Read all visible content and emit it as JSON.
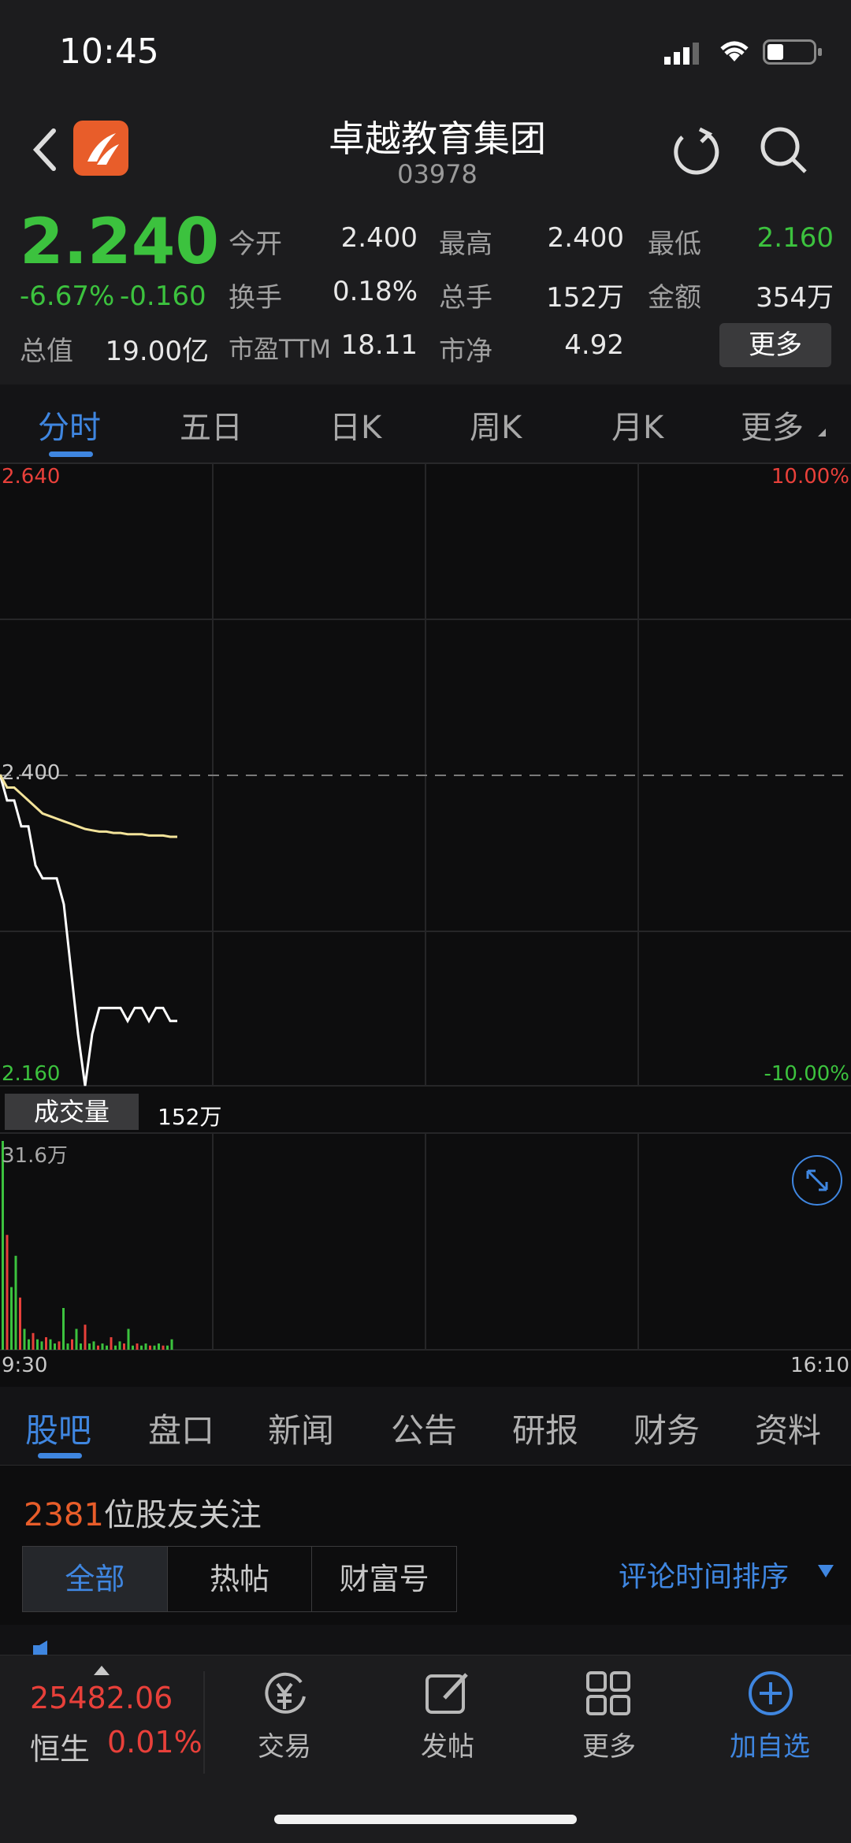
{
  "status_bar": {
    "time": "10:45"
  },
  "header": {
    "title": "卓越教育集团",
    "code": "03978"
  },
  "quote": {
    "price": "2.240",
    "change_pct": "-6.67%",
    "change_abs": "-0.160",
    "rows": [
      [
        {
          "label": "今开",
          "value": "2.400"
        },
        {
          "label": "最高",
          "value": "2.400"
        },
        {
          "label": "最低",
          "value": "2.160"
        }
      ],
      [
        {
          "label": "换手",
          "value": "0.18%"
        },
        {
          "label": "总手",
          "value": "152万"
        },
        {
          "label": "金额",
          "value": "354万"
        }
      ]
    ],
    "row3": {
      "total_label": "总值",
      "total_value": "19.00亿",
      "pe_label": "市盈TTM",
      "pe_value": "18.11",
      "pb_label": "市净",
      "pb_value": "4.92"
    },
    "more_button": "更多"
  },
  "chart_tabs": [
    "分时",
    "五日",
    "日K",
    "周K",
    "月K",
    "更多"
  ],
  "chart_data": {
    "type": "line",
    "y_left_ticks": [
      "2.640",
      "2.400",
      "2.160"
    ],
    "y_right_ticks": [
      "10.00%",
      "-10.00%"
    ],
    "ylim": [
      2.16,
      2.64
    ],
    "prev_close": 2.4,
    "series": [
      {
        "values": [
          2.4,
          2.38,
          2.38,
          2.36,
          2.36,
          2.33,
          2.32,
          2.32,
          2.32,
          2.3,
          2.25,
          2.2,
          2.16,
          2.2,
          2.22,
          2.22,
          2.22,
          2.22,
          2.21,
          2.22,
          2.22,
          2.21,
          2.22,
          2.22,
          2.21,
          2.21
        ]
      },
      {
        "values": [
          2.4,
          2.39,
          2.39,
          2.385,
          2.38,
          2.375,
          2.37,
          2.368,
          2.366,
          2.364,
          2.362,
          2.36,
          2.358,
          2.357,
          2.356,
          2.356,
          2.355,
          2.355,
          2.354,
          2.354,
          2.354,
          2.353,
          2.353,
          2.353,
          2.352,
          2.352
        ]
      }
    ],
    "volume": {
      "label": "成交量",
      "total": "152万",
      "max_label": "31.6万",
      "x_start": "9:30",
      "x_end": "16:10",
      "bars": [
        1.0,
        0.55,
        0.3,
        0.45,
        0.25,
        0.1,
        0.05,
        0.08,
        0.05,
        0.04,
        0.06,
        0.05,
        0.03,
        0.04,
        0.2,
        0.03,
        0.05,
        0.1,
        0.03,
        0.12,
        0.03,
        0.04,
        0.02,
        0.03,
        0.02,
        0.06,
        0.02,
        0.04,
        0.03,
        0.1,
        0.02,
        0.03,
        0.02,
        0.03,
        0.02,
        0.02,
        0.03,
        0.02,
        0.02,
        0.05
      ]
    }
  },
  "sub_tabs": [
    "股吧",
    "盘口",
    "新闻",
    "公告",
    "研报",
    "财务",
    "资料"
  ],
  "followers": {
    "count": "2381",
    "text": "位股友关注"
  },
  "filter_tabs": [
    "全部",
    "热帖",
    "财富号"
  ],
  "sort_label": "评论时间排序",
  "bottom_bar": {
    "index_value": "25482.06",
    "index_name": "恒生",
    "index_change": "0.01%",
    "items": [
      "交易",
      "发帖",
      "更多",
      "加自选"
    ]
  },
  "colors": {
    "up": "#e8403a",
    "down": "#3cc23e",
    "accent": "#3f86e0",
    "avg_line": "#f3e39a"
  }
}
